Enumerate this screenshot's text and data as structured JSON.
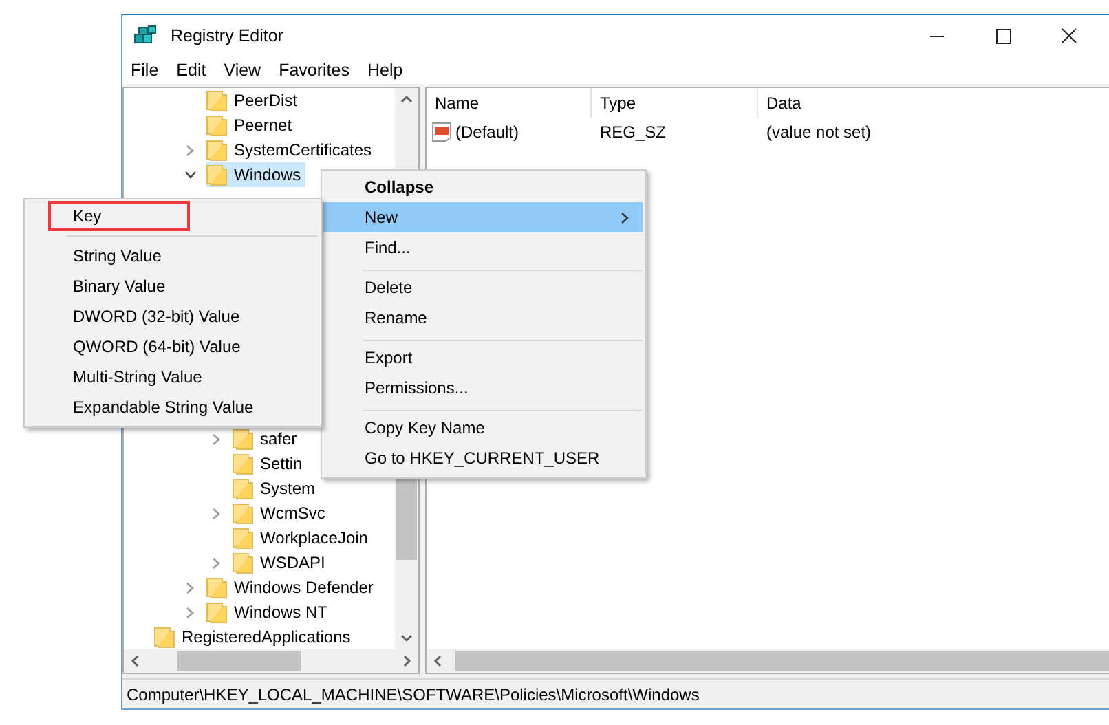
{
  "window": {
    "title": "Registry Editor"
  },
  "menu_bar": [
    "File",
    "Edit",
    "View",
    "Favorites",
    "Help"
  ],
  "tree": {
    "items": [
      {
        "children": [
          {
            "children": [
              {
                "label": "PeerDist",
                "selected": false
              },
              {
                "label": "Peernet",
                "selected": false
              },
              {
                "label": "SystemCertificates",
                "expanded": false,
                "selected": false
              },
              {
                "label": "Windows",
                "expanded": true,
                "selected": true,
                "children": [
                  {
                    "label": "safer",
                    "expanded": false,
                    "selected": false
                  },
                  {
                    "label": "Settin",
                    "selected": false
                  },
                  {
                    "label": "System",
                    "selected": false
                  },
                  {
                    "label": "WcmSvc",
                    "expanded": false,
                    "selected": false
                  },
                  {
                    "label": "WorkplaceJoin",
                    "selected": false
                  },
                  {
                    "label": "WSDAPI",
                    "expanded": false,
                    "selected": false
                  }
                ]
              },
              {
                "label": "Windows Defender",
                "expanded": false,
                "selected": false
              },
              {
                "label": "Windows NT",
                "expanded": false,
                "selected": false
              }
            ]
          }
        ]
      },
      {
        "label": "RegisteredApplications",
        "selected": false
      }
    ]
  },
  "values": {
    "columns": [
      "Name",
      "Type",
      "Data"
    ],
    "rows": [
      {
        "name": "(Default)",
        "type": "REG_SZ",
        "data": "(value not set)"
      }
    ]
  },
  "context_menu": {
    "groups": [
      [
        {
          "label": "Collapse",
          "bold": true,
          "selected": false,
          "submenu": false
        },
        {
          "label": "New",
          "bold": false,
          "selected": true,
          "submenu": true
        },
        {
          "label": "Find...",
          "bold": false,
          "selected": false,
          "submenu": false
        }
      ],
      [
        {
          "label": "Delete",
          "bold": false,
          "selected": false,
          "submenu": false
        },
        {
          "label": "Rename",
          "bold": false,
          "selected": false,
          "submenu": false
        }
      ],
      [
        {
          "label": "Export",
          "bold": false,
          "selected": false,
          "submenu": false
        },
        {
          "label": "Permissions...",
          "bold": false,
          "selected": false,
          "submenu": false
        }
      ],
      [
        {
          "label": "Copy Key Name",
          "bold": false,
          "selected": false,
          "submenu": false
        },
        {
          "label": "Go to HKEY_CURRENT_USER",
          "bold": false,
          "selected": false,
          "submenu": false
        }
      ]
    ]
  },
  "submenu": {
    "groups": [
      [
        {
          "label": "Key",
          "highlighted": true
        }
      ],
      [
        {
          "label": "String Value",
          "highlighted": false
        },
        {
          "label": "Binary Value",
          "highlighted": false
        },
        {
          "label": "DWORD (32-bit) Value",
          "highlighted": false
        },
        {
          "label": "QWORD (64-bit) Value",
          "highlighted": false
        },
        {
          "label": "Multi-String Value",
          "highlighted": false
        },
        {
          "label": "Expandable String Value",
          "highlighted": false
        }
      ]
    ]
  },
  "status_bar": "Computer\\HKEY_LOCAL_MACHINE\\SOFTWARE\\Policies\\Microsoft\\Windows"
}
